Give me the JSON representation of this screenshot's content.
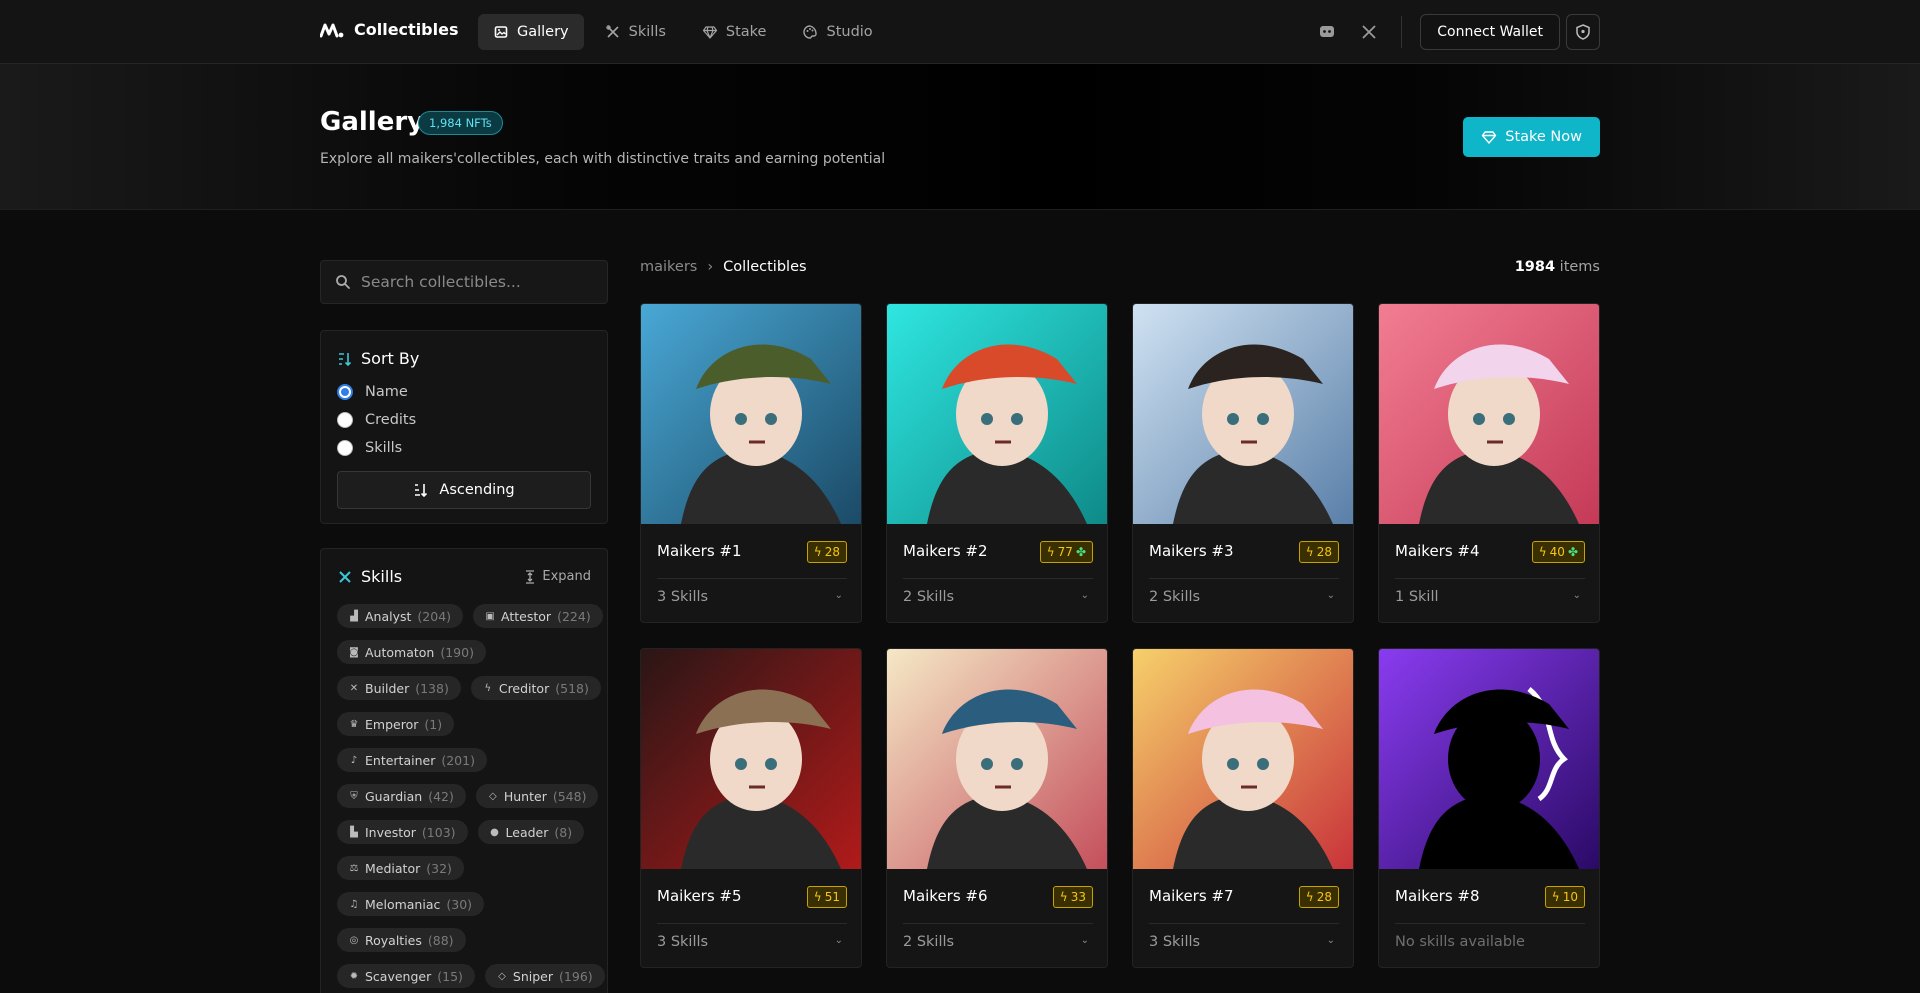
{
  "nav": {
    "brand": "Collectibles",
    "tabs": [
      {
        "label": "Gallery",
        "icon": "image-icon",
        "active": true
      },
      {
        "label": "Skills",
        "icon": "tools-icon"
      },
      {
        "label": "Stake",
        "icon": "diamond-icon"
      },
      {
        "label": "Studio",
        "icon": "palette-icon"
      }
    ],
    "connect_label": "Connect Wallet"
  },
  "hero": {
    "title": "Gallery",
    "badge": "1,984 NFTs",
    "subtitle": "Explore all maikers'collectibles, each with distinctive traits and earning potential",
    "stake_label": "Stake Now"
  },
  "search": {
    "placeholder": "Search collectibles..."
  },
  "sort": {
    "title": "Sort By",
    "options": [
      "Name",
      "Credits",
      "Skills"
    ],
    "selected": "Name",
    "order_label": "Ascending"
  },
  "skills": {
    "title": "Skills",
    "expand_label": "Expand",
    "items": [
      {
        "name": "Analyst",
        "count": "(204)"
      },
      {
        "name": "Attestor",
        "count": "(224)"
      },
      {
        "name": "Automaton",
        "count": "(190)"
      },
      {
        "name": "Builder",
        "count": "(138)"
      },
      {
        "name": "Creditor",
        "count": "(518)"
      },
      {
        "name": "Emperor",
        "count": "(1)"
      },
      {
        "name": "Entertainer",
        "count": "(201)"
      },
      {
        "name": "Guardian",
        "count": "(42)"
      },
      {
        "name": "Hunter",
        "count": "(548)"
      },
      {
        "name": "Investor",
        "count": "(103)"
      },
      {
        "name": "Leader",
        "count": "(8)"
      },
      {
        "name": "Mediator",
        "count": "(32)"
      },
      {
        "name": "Melomaniac",
        "count": "(30)"
      },
      {
        "name": "Royalties",
        "count": "(88)"
      },
      {
        "name": "Scavenger",
        "count": "(15)"
      },
      {
        "name": "Sniper",
        "count": "(196)"
      }
    ]
  },
  "breadcrumb": {
    "root": "maikers",
    "current": "Collectibles"
  },
  "items_count": {
    "value": "1984",
    "label": "items"
  },
  "cards": [
    {
      "name": "Maikers #1",
      "credits": "28",
      "clover": false,
      "skills": "3 Skills",
      "bg": [
        "#49a8d6",
        "#1b4a66"
      ],
      "hat": "#4c5d2c"
    },
    {
      "name": "Maikers #2",
      "credits": "77",
      "clover": true,
      "skills": "2 Skills",
      "bg": [
        "#2fe6e0",
        "#0e8a88"
      ],
      "hat": "#d94a2b"
    },
    {
      "name": "Maikers #3",
      "credits": "28",
      "clover": false,
      "skills": "2 Skills",
      "bg": [
        "#cfe2f2",
        "#5a7fa8"
      ],
      "hat": "#2a2320"
    },
    {
      "name": "Maikers #4",
      "credits": "40",
      "clover": true,
      "skills": "1 Skill",
      "bg": [
        "#f27d92",
        "#c43a57"
      ],
      "hat": "#f2d4ec"
    },
    {
      "name": "Maikers #5",
      "credits": "51",
      "clover": false,
      "skills": "3 Skills",
      "bg": [
        "#2a1616",
        "#b11a1a"
      ],
      "hat": "#8c7054"
    },
    {
      "name": "Maikers #6",
      "credits": "33",
      "clover": false,
      "skills": "2 Skills",
      "bg": [
        "#f5e8c6",
        "#c44f5c"
      ],
      "hat": "#2a5d7e"
    },
    {
      "name": "Maikers #7",
      "credits": "28",
      "clover": false,
      "skills": "3 Skills",
      "bg": [
        "#f6d06a",
        "#c9333a"
      ],
      "hat": "#f4c1e0"
    },
    {
      "name": "Maikers #8",
      "credits": "10",
      "clover": false,
      "skills": "No skills available",
      "bg": [
        "#8a3cf0",
        "#2a0a66"
      ],
      "hat": "#000000"
    }
  ]
}
